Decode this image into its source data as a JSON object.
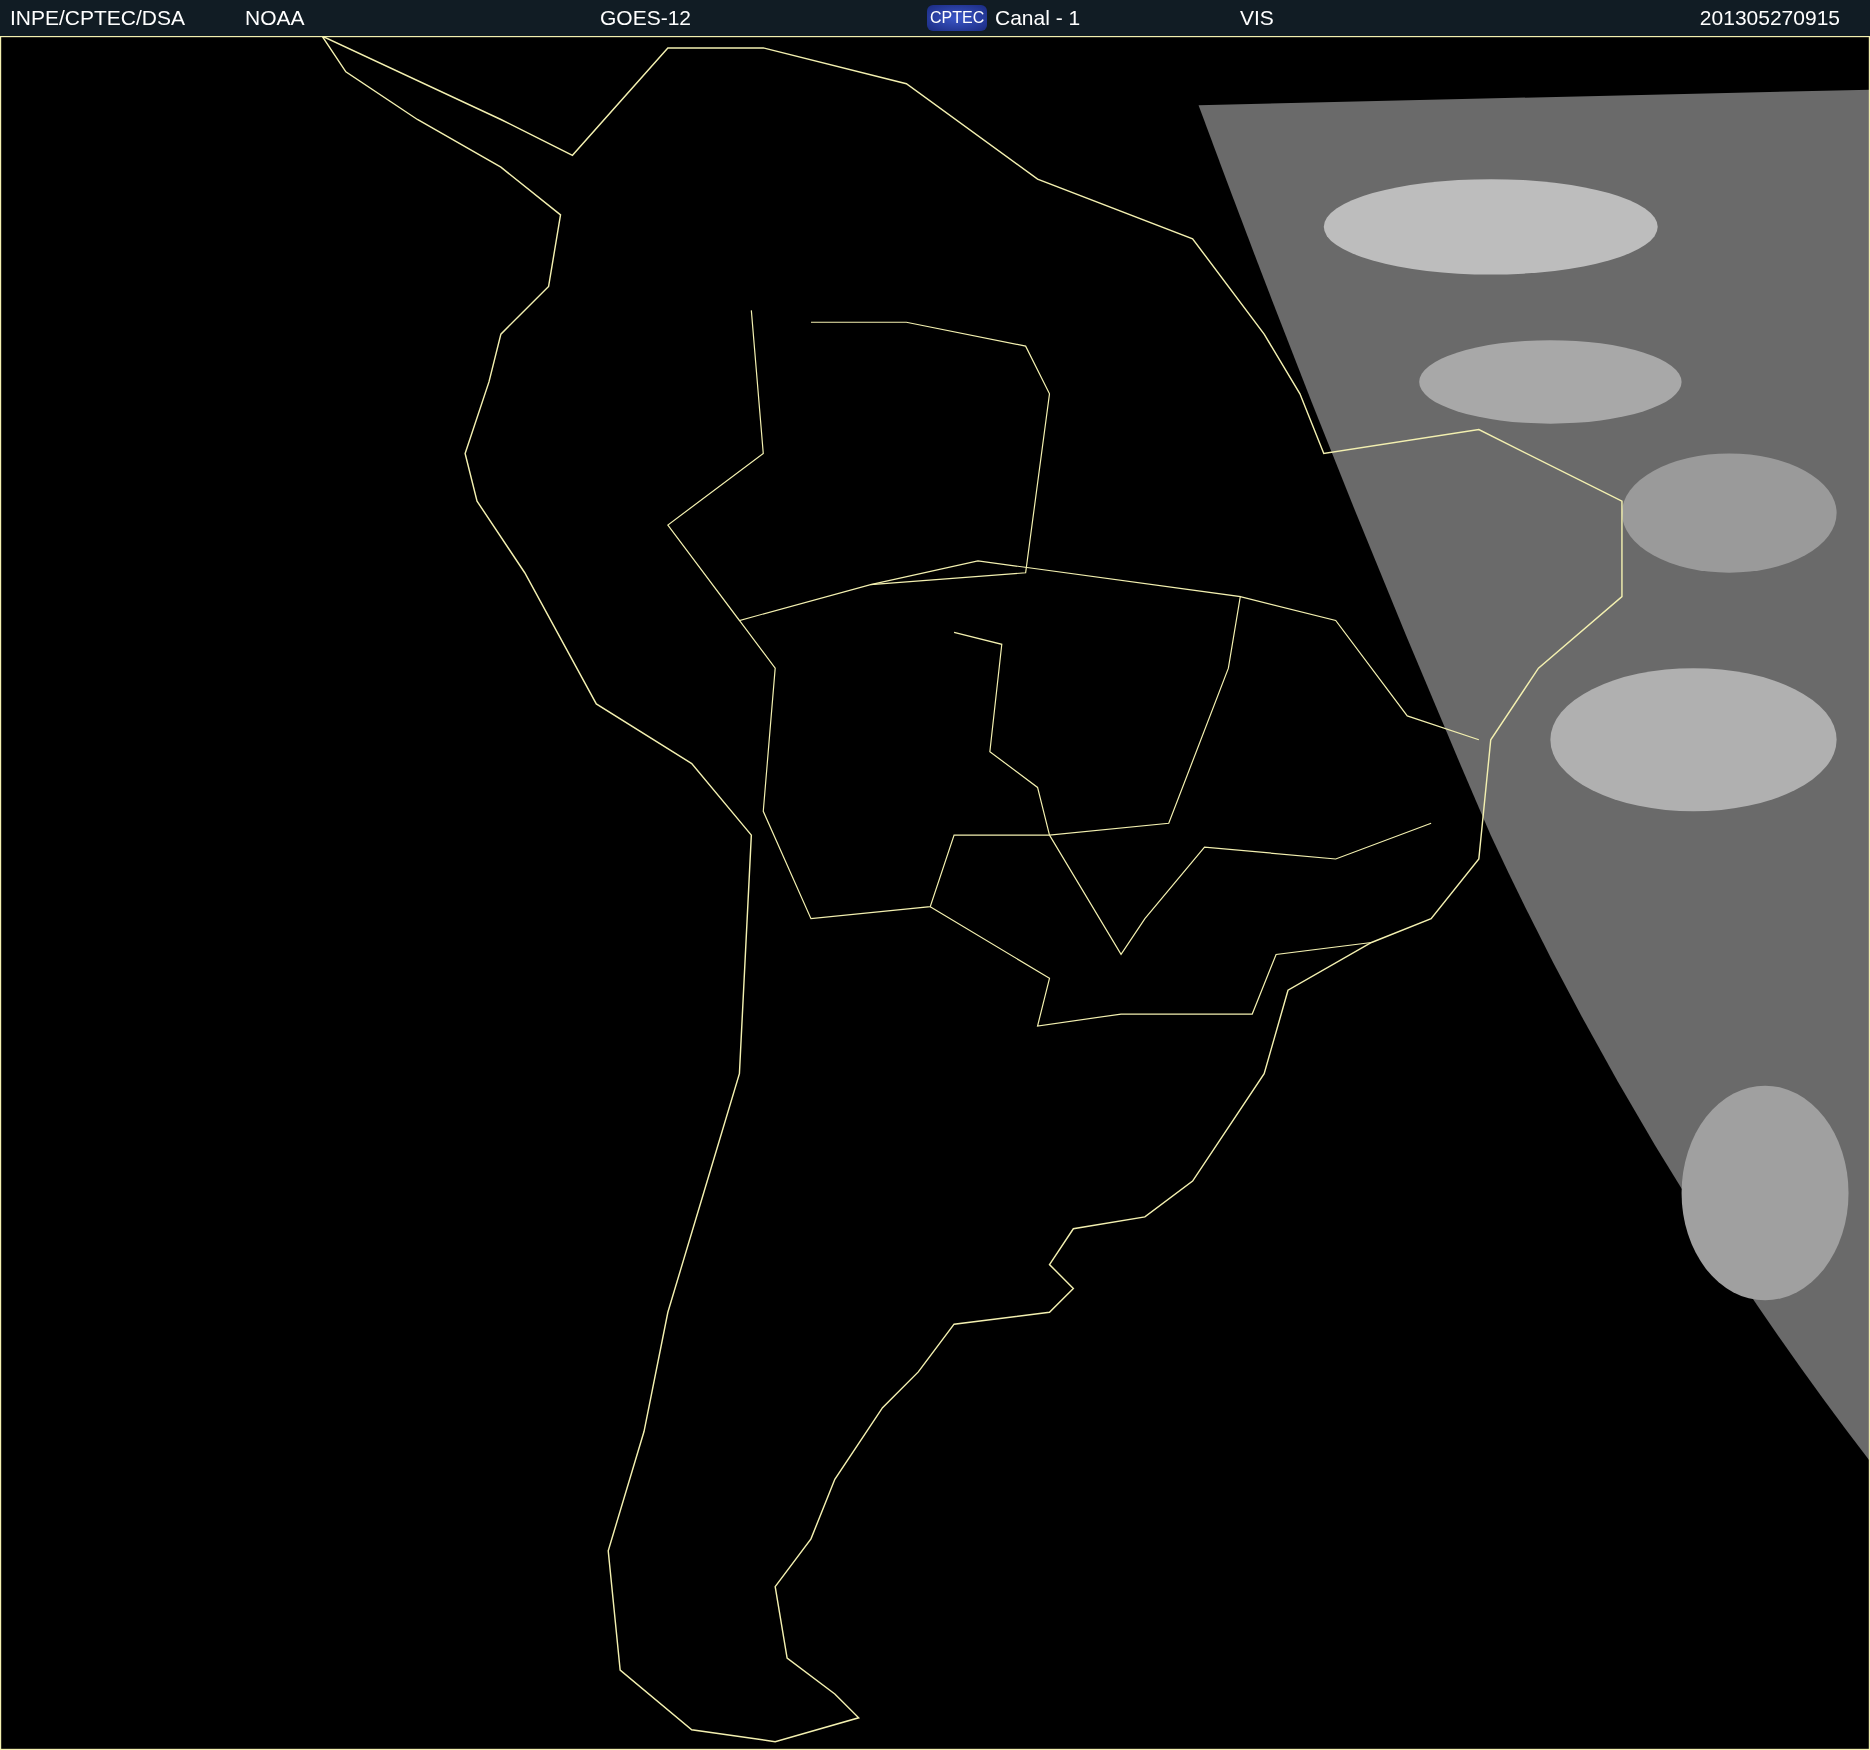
{
  "header": {
    "source": "INPE/CPTEC/DSA",
    "agency": "NOAA",
    "satellite": "GOES-12",
    "logo": "CPTEC",
    "channel": "Canal - 1",
    "band": "VIS",
    "timestamp": "201305270915"
  }
}
